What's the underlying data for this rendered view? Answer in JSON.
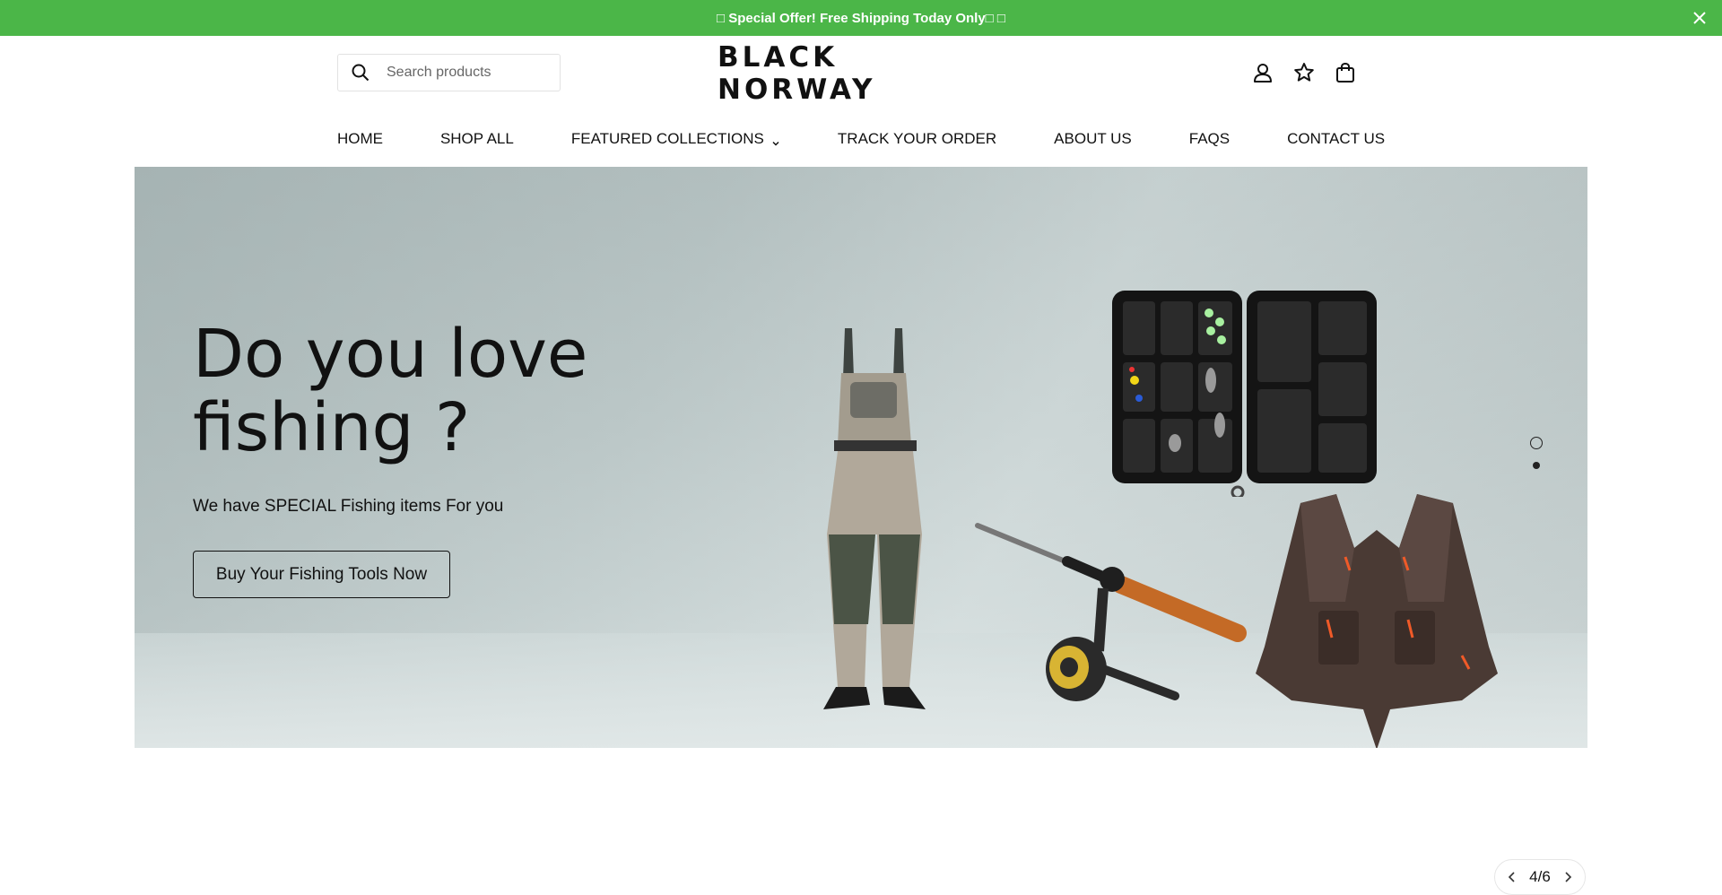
{
  "announcement": {
    "text": "□ Special Offer! Free Shipping Today Only□ □",
    "close_icon": "close-icon",
    "background": "#4bb648"
  },
  "header": {
    "search": {
      "placeholder": "Search products",
      "value": "",
      "icon": "search-icon"
    },
    "logo": "BLACK NORWAY",
    "icons": [
      "account-icon",
      "wishlist-star-icon",
      "shopping-bag-icon"
    ]
  },
  "nav": {
    "items": [
      {
        "label": "HOME"
      },
      {
        "label": "SHOP ALL"
      },
      {
        "label": "FEATURED COLLECTIONS",
        "dropdown": true
      },
      {
        "label": "TRACK YOUR ORDER"
      },
      {
        "label": "ABOUT US"
      },
      {
        "label": "FAQS"
      },
      {
        "label": "CONTACT US"
      }
    ]
  },
  "hero": {
    "title": "Do you love fishing ?",
    "subtitle": "We have SPECIAL Fishing items For you",
    "button": "Buy Your Fishing Tools Now",
    "slide_count": 2,
    "active_slide": 2
  },
  "pager": {
    "label": "4/6",
    "prev_icon": "chevron-left-icon",
    "next_icon": "chevron-right-icon"
  }
}
